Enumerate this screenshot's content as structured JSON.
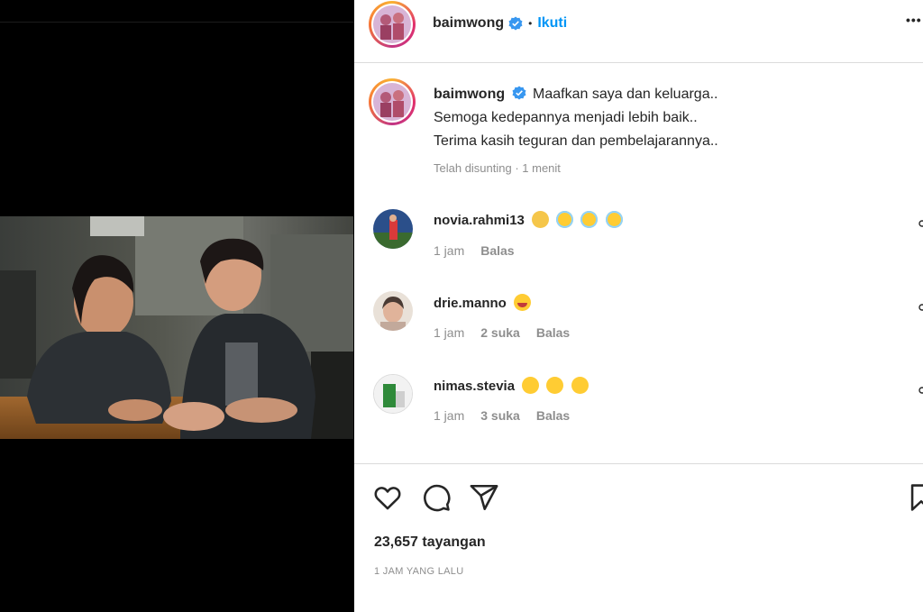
{
  "post": {
    "username": "baimwong",
    "follow_label": "Ikuti",
    "separator": "•",
    "more_label": "•••"
  },
  "caption": {
    "username": "baimwong",
    "line1": "Maafkan saya dan keluarga..",
    "line2": "Semoga kedepannya menjadi lebih baik..",
    "line3": "Terima kasih teguran dan pembelajarannya..",
    "meta": "Telah disunting · 1 menit"
  },
  "comments": [
    {
      "username": "novia.rahmi13",
      "emojis": [
        "person-praying-emoji",
        "angel-face-emoji",
        "angel-face-emoji",
        "angel-face-emoji"
      ],
      "time": "1 jam",
      "likes": "",
      "reply": "Balas"
    },
    {
      "username": "drie.manno",
      "emojis": [
        "laughing-face-emoji"
      ],
      "time": "1 jam",
      "likes": "2 suka",
      "reply": "Balas"
    },
    {
      "username": "nimas.stevia",
      "emojis": [
        "eye-roll-emoji",
        "eye-roll-emoji",
        "eye-roll-emoji"
      ],
      "time": "1 jam",
      "likes": "3 suka",
      "reply": "Balas"
    }
  ],
  "stats": {
    "views": "23,657 tayangan",
    "time_ago": "1 JAM YANG LALU"
  },
  "icons": {
    "like": "heart-icon",
    "comment": "comment-icon",
    "share": "share-icon",
    "save": "bookmark-icon",
    "verified": "verified-badge-icon",
    "more": "more-options-icon"
  },
  "colors": {
    "accent": "#0095f6",
    "verified": "#3897f0",
    "muted": "#8e8e8e",
    "divider": "#dbdbdb"
  }
}
